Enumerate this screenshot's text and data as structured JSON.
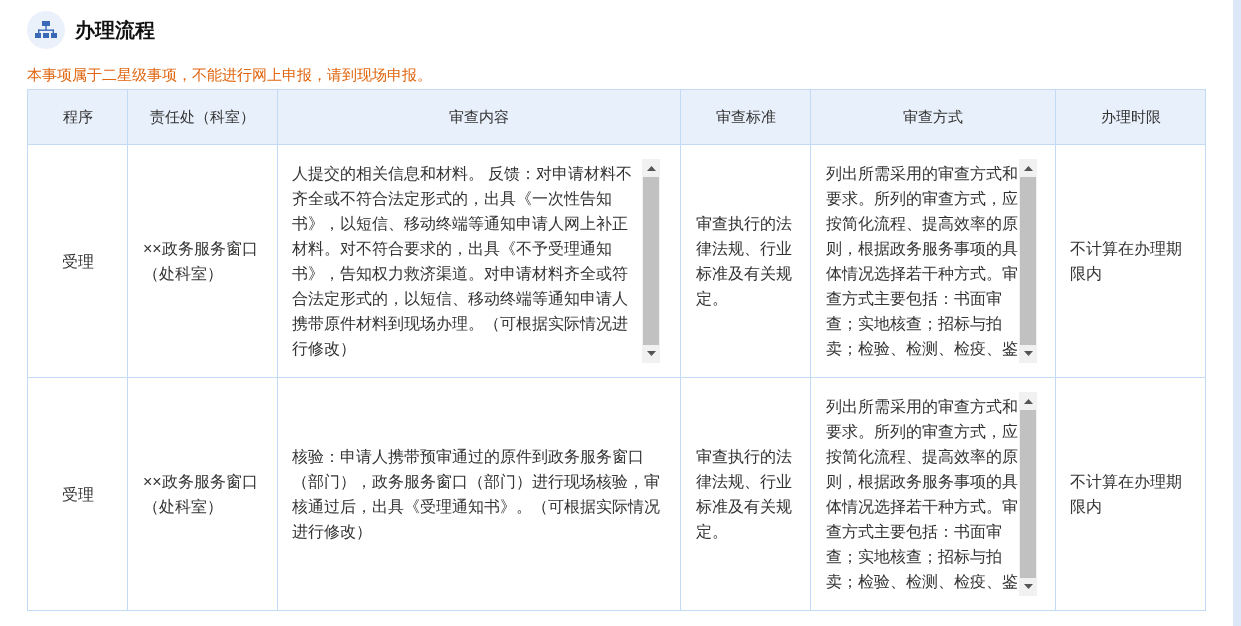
{
  "title": "办理流程",
  "notice": "本事项属于二星级事项，不能进行网上申报，请到现场申报。",
  "table": {
    "columns": [
      "程序",
      "责任处（科室）",
      "审查内容",
      "审查标准",
      "审查方式",
      "办理时限"
    ],
    "rows": [
      {
        "step": "受理",
        "department": "××政务服务窗口（处科室）",
        "content": "人提交的相关信息和材料。 反馈：对申请材料不齐全或不符合法定形式的，出具《一次性告知书》，以短信、移动终端等通知申请人网上补正材料。对不符合要求的，出具《不予受理通知书》，告知权力救济渠道。对申请材料齐全或符合法定形式的，以短信、移动终端等通知申请人携带原件材料到现场办理。（可根据实际情况进行修改）",
        "content_scrollable": true,
        "standard": "审查执行的法律法规、行业标准及有关规定。",
        "method": "列出所需采用的审查方式和要求。所列的审查方式，应按简化流程、提高效率的原则，根据政务服务事项的具体情况选择若干种方式。审查方式主要包括：书面审查；实地核查；招标与拍卖；检验、检测、检疫、鉴",
        "method_scrollable": true,
        "time_limit": "不计算在办理期限内"
      },
      {
        "step": "受理",
        "department": "××政务服务窗口（处科室）",
        "content": "核验：申请人携带预审通过的原件到政务服务窗口（部门），政务服务窗口（部门）进行现场核验，审核通过后，出具《受理通知书》。（可根据实际情况进行修改）",
        "content_scrollable": false,
        "standard": "审查执行的法律法规、行业标准及有关规定。",
        "method": "列出所需采用的审查方式和要求。所列的审查方式，应按简化流程、提高效率的原则，根据政务服务事项的具体情况选择若干种方式。审查方式主要包括：书面审查；实地核查；招标与拍卖；检验、检测、检疫、鉴",
        "method_scrollable": true,
        "time_limit": "不计算在办理期限内"
      }
    ]
  }
}
